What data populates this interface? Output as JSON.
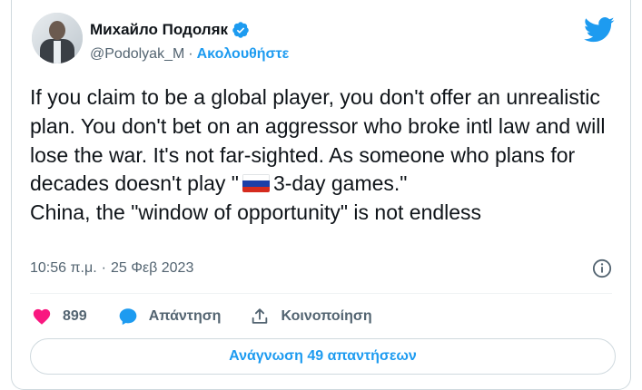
{
  "author": {
    "name": "Михайло Подоляк",
    "handle": "@Podolyak_M",
    "separator": "·",
    "follow_label": "Ακολουθήστε"
  },
  "tweet": {
    "text_before_flag": "If you claim to be a global player, you don't offer an unrealistic plan. You don't bet on an aggressor who broke intl law and will lose the war. It's not far-sighted. As someone who plans for decades doesn't play \"",
    "text_after_flag": "3-day games.\"\nChina, the \"window of opportunity\" is not endless",
    "flag": "russia-flag",
    "time": "10:56 π.μ.",
    "date": "25 Φεβ 2023",
    "date_separator": "·"
  },
  "actions": {
    "like_count": "899",
    "reply_label": "Απάντηση",
    "share_label": "Κοινοποίηση"
  },
  "read_replies_label": "Ανάγνωση 49 απαντήσεων",
  "colors": {
    "accent": "#1d9bf0",
    "like": "#f91880",
    "muted": "#536471",
    "text": "#0f1419"
  },
  "icons": {
    "verified": "verified-badge-icon",
    "logo": "twitter-bird-icon",
    "info": "info-icon",
    "like": "heart-icon",
    "reply": "speech-bubble-icon",
    "share": "share-upload-icon"
  }
}
